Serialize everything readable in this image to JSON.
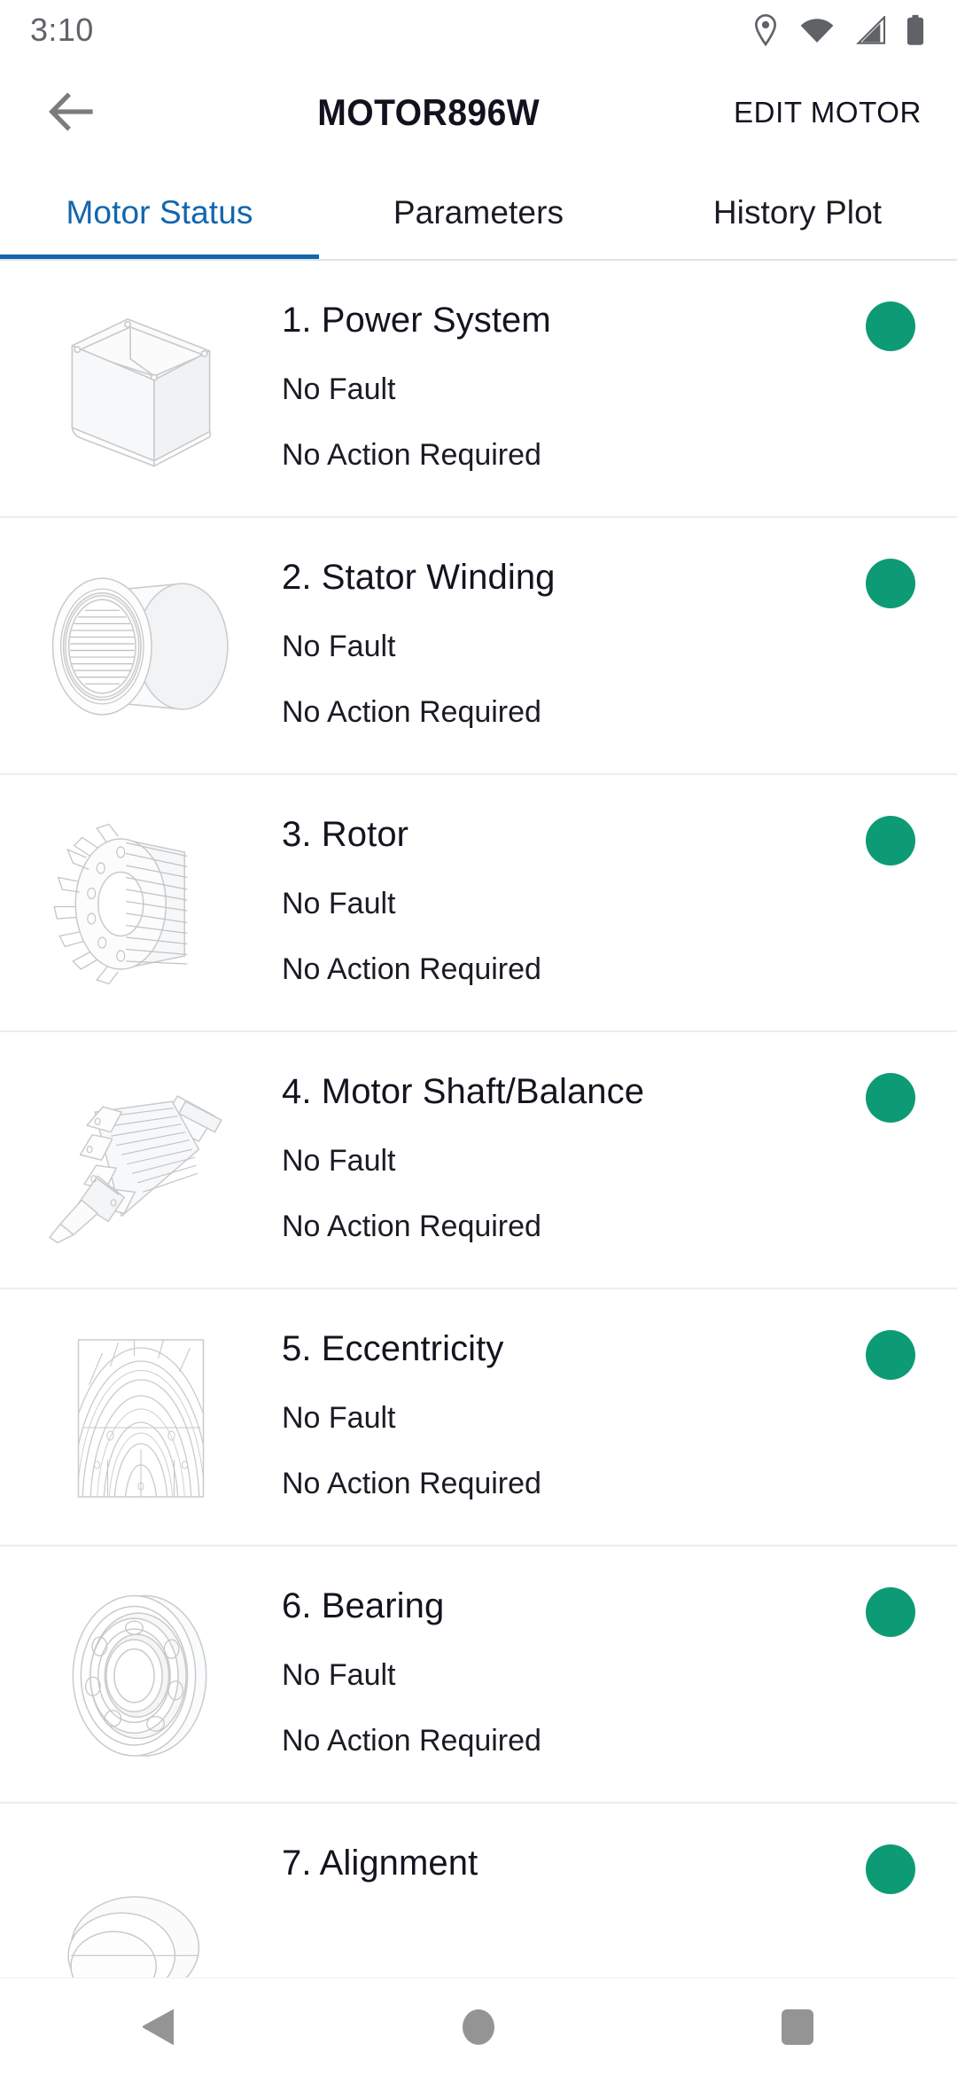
{
  "status_bar": {
    "time": "3:10",
    "icons": [
      "location-icon",
      "wifi-icon",
      "cellular-signal-icon",
      "battery-icon"
    ]
  },
  "app_bar": {
    "back_icon": "arrow-left-icon",
    "title": "MOTOR896W",
    "edit_label": "EDIT MOTOR"
  },
  "tabs": [
    {
      "label": "Motor Status",
      "active": true
    },
    {
      "label": "Parameters",
      "active": false
    },
    {
      "label": "History Plot",
      "active": false
    }
  ],
  "colors": {
    "accent_blue": "#1266ae",
    "status_green": "#0d9b75",
    "text_primary": "#14141f",
    "divider": "#eceded",
    "icon_gray": "#7c7c7c",
    "nav_gray": "#949494"
  },
  "list": {
    "items": [
      {
        "title": "1. Power System",
        "fault": "No Fault",
        "action": "No Action Required",
        "status": "green",
        "thumb": "power-system-box-icon"
      },
      {
        "title": "2. Stator Winding",
        "fault": "No Fault",
        "action": "No Action Required",
        "status": "green",
        "thumb": "stator-winding-icon"
      },
      {
        "title": "3. Rotor",
        "fault": "No Fault",
        "action": "No Action Required",
        "status": "green",
        "thumb": "rotor-icon"
      },
      {
        "title": "4. Motor Shaft/Balance",
        "fault": "No Fault",
        "action": "No Action Required",
        "status": "green",
        "thumb": "motor-shaft-icon"
      },
      {
        "title": "5. Eccentricity",
        "fault": "No Fault",
        "action": "No Action Required",
        "status": "green",
        "thumb": "eccentricity-icon"
      },
      {
        "title": "6. Bearing",
        "fault": "No Fault",
        "action": "No Action Required",
        "status": "green",
        "thumb": "bearing-icon"
      },
      {
        "title": "7. Alignment",
        "fault": "",
        "action": "",
        "status": "green",
        "thumb": "alignment-icon"
      }
    ]
  },
  "nav_bar": {
    "back": "nav-back-triangle-icon",
    "home": "nav-home-circle-icon",
    "recents": "nav-recents-square-icon"
  }
}
